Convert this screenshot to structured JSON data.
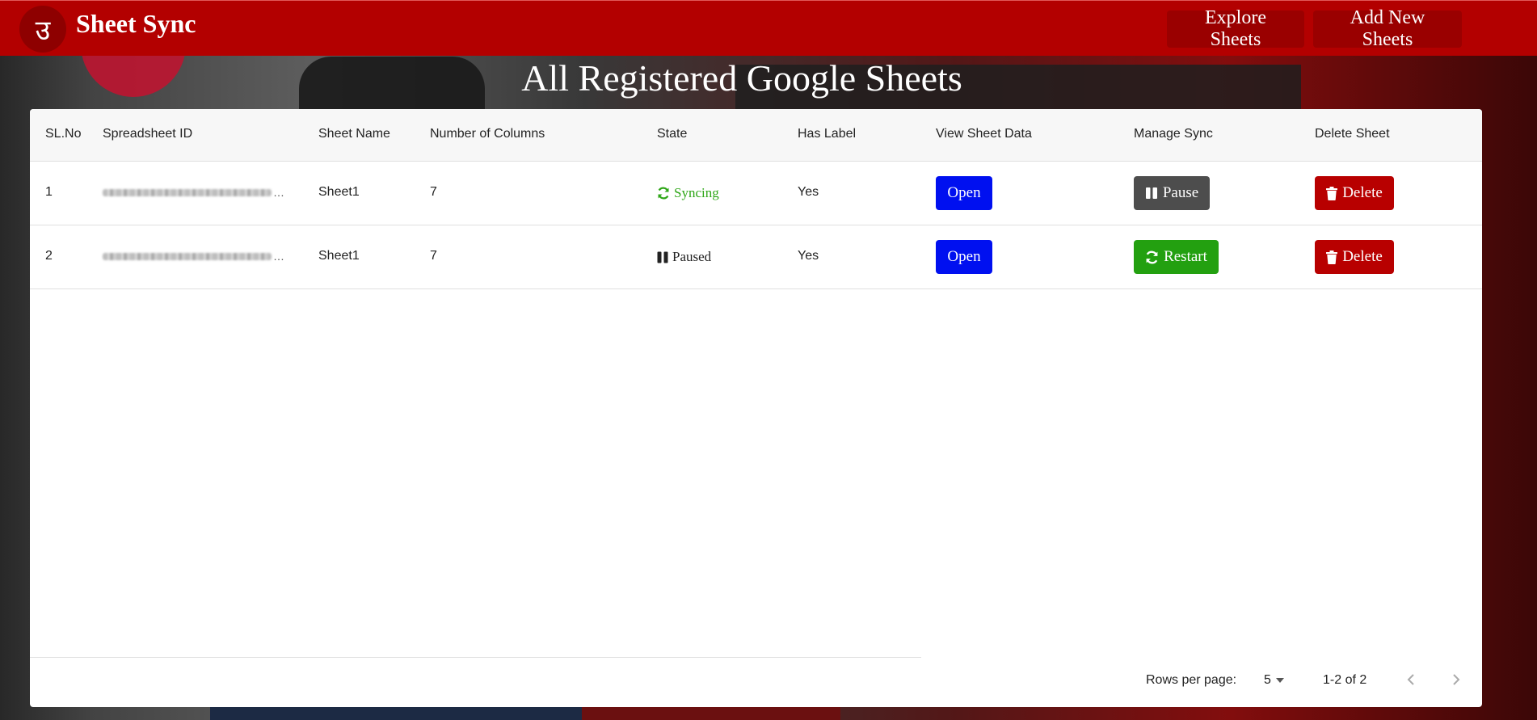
{
  "header": {
    "logo_glyph": "उ",
    "brand": "Sheet Sync",
    "explore_label": "Explore Sheets",
    "add_label": "Add New Sheets"
  },
  "page_title": "All Registered Google Sheets",
  "table": {
    "columns": [
      "SL.No",
      "Spreadsheet ID",
      "Sheet Name",
      "Number of Columns",
      "State",
      "Has Label",
      "View Sheet Data",
      "Manage Sync",
      "Delete Sheet"
    ],
    "rows": [
      {
        "sl": "1",
        "spreadsheet_id_suffix": "…",
        "sheet_name": "Sheet1",
        "num_columns": "7",
        "state": "Syncing",
        "has_label": "Yes",
        "view_label": "Open",
        "sync_label": "Pause",
        "delete_label": "Delete"
      },
      {
        "sl": "2",
        "spreadsheet_id_suffix": "…",
        "sheet_name": "Sheet1",
        "num_columns": "7",
        "state": "Paused",
        "has_label": "Yes",
        "view_label": "Open",
        "sync_label": "Restart",
        "delete_label": "Delete"
      }
    ]
  },
  "footer": {
    "rows_per_page_label": "Rows per page:",
    "rows_per_page_value": "5",
    "range_text": "1-2 of 2"
  },
  "colors": {
    "navbar": "#b30000",
    "open_button": "#0010f0",
    "pause_button": "#4d4d4d",
    "restart_button": "#23a010",
    "delete_button": "#b80000",
    "syncing_text": "#2ea617"
  }
}
